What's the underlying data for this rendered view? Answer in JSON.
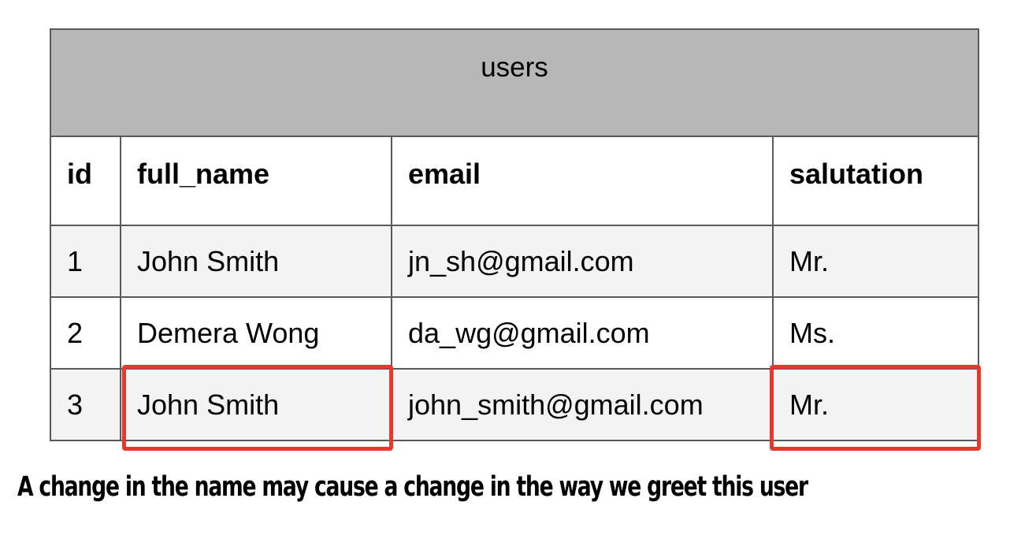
{
  "table": {
    "title": "users",
    "columns": [
      "id",
      "full_name",
      "email",
      "salutation"
    ],
    "rows": [
      [
        "1",
        "John Smith",
        "jn_sh@gmail.com",
        "Mr."
      ],
      [
        "2",
        "Demera Wong",
        "da_wg@gmail.com",
        "Ms."
      ],
      [
        "3",
        "John Smith",
        "john_smith@gmail.com",
        "Mr."
      ]
    ]
  },
  "highlights": [
    "row 3 full_name",
    "row 3 salutation"
  ],
  "colors": {
    "title_background": "#b7b7b7",
    "shaded_row": "#f3f3f3",
    "border": "#595959",
    "highlight": "#e8382c"
  },
  "caption": "A change in the name may cause a change in the way we greet this user"
}
